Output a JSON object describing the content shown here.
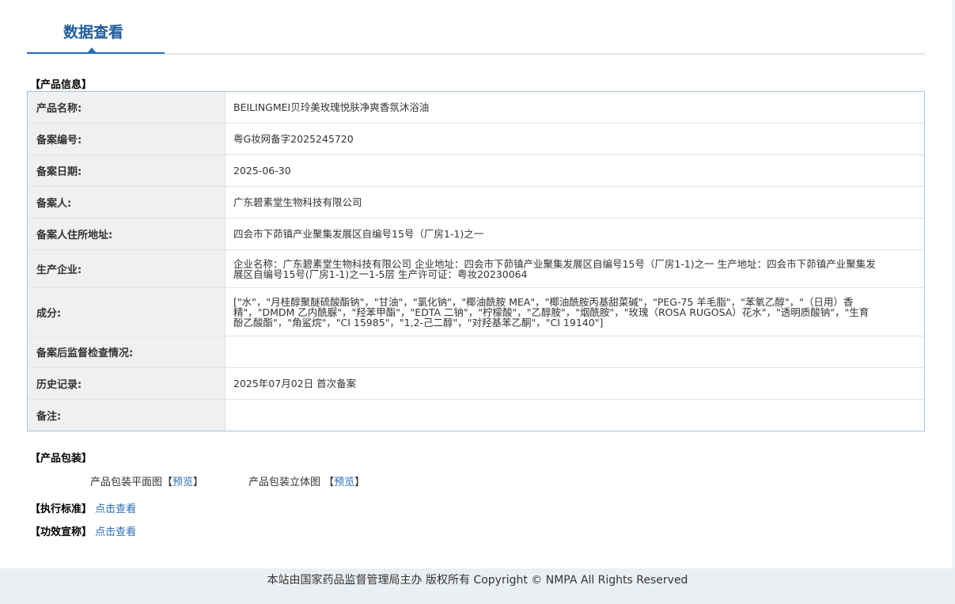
{
  "tabs": {
    "active_label": "数据查看"
  },
  "product_info": {
    "heading": "【产品信息】",
    "rows": [
      {
        "label": "产品名称:",
        "value": "BEILINGMEI贝玲美玫瑰悦肤净爽香氛沐浴油"
      },
      {
        "label": "备案编号:",
        "value": "粤G妆网备字2025245720"
      },
      {
        "label": "备案日期:",
        "value": "2025-06-30"
      },
      {
        "label": "备案人:",
        "value": "广东碧素堂生物科技有限公司"
      },
      {
        "label": "备案人住所地址:",
        "value": "四会市下茆镇产业聚集发展区自编号15号（厂房1-1)之一"
      },
      {
        "label": "生产企业:",
        "value": "企业名称：广东碧素堂生物科技有限公司 企业地址：四会市下茆镇产业聚集发展区自编号15号（厂房1-1)之一 生产地址：四会市下茆镇产业聚集发展区自编号15号(厂房1-1)之一1-5层 生产许可证：粤妆20230064"
      },
      {
        "label": "成分:",
        "value": "[\"水\"，\"月桂醇聚醚硫酸酯钠\"，\"甘油\"，\"氯化钠\"，\"椰油酰胺 MEA\"，\"椰油酰胺丙基甜菜碱\"，\"PEG-75 羊毛脂\"，\"苯氧乙醇\"，\"（日用）香精\"，\"DMDM 乙内酰脲\"，\"羟苯甲酯\"，\"EDTA 二钠\"，\"柠檬酸\"，\"乙醇胺\"，\"烟酰胺\"，\"玫瑰（ROSA RUGOSA）花水\"，\"透明质酸钠\"，\"生育酚乙酸酯\"，\"角鲨烷\"，\"CI 15985\"，\"1,2-己二醇\"，\"对羟基苯乙酮\"，\"CI 19140\"]"
      },
      {
        "label": "备案后监督检查情况:",
        "value": ""
      },
      {
        "label": "历史记录:",
        "value": "2025年07月02日 首次备案"
      },
      {
        "label": "备注:",
        "value": ""
      }
    ]
  },
  "packaging": {
    "heading": "【产品包装】",
    "flat_label": "产品包装平面图【",
    "flat_link": "预览",
    "flat_close": "】",
    "stereo_label": "产品包装立体图 【",
    "stereo_link": "预览",
    "stereo_close": "】"
  },
  "standard": {
    "label": "【执行标准】",
    "link": "点击查看"
  },
  "efficacy": {
    "label": "【功效宣称】",
    "link": "点击查看"
  },
  "footer": {
    "text": "本站由国家药品监督管理局主办 版权所有 Copyright © NMPA All Rights Reserved"
  }
}
